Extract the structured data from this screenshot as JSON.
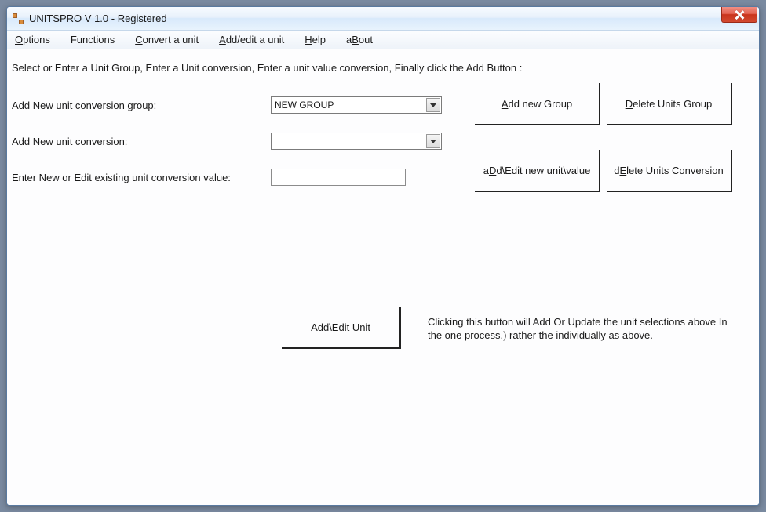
{
  "window": {
    "title": "UNITSPRO V 1.0 - Registered"
  },
  "menu": {
    "options": "Options",
    "functions": "Functions",
    "convert": "Convert a unit",
    "addedit": "Add/edit a unit",
    "help": "Help",
    "about": "aBout"
  },
  "labels": {
    "instruction": "Select or Enter a Unit Group, Enter a Unit conversion, Enter a unit value conversion, Finally click the Add Button :",
    "add_group": "Add New unit conversion group:",
    "add_conversion": "Add New unit conversion:",
    "enter_value": "Enter New or Edit existing unit conversion value:"
  },
  "fields": {
    "group_selected": "NEW GROUP",
    "conversion_selected": "",
    "value_text": ""
  },
  "buttons": {
    "add_group": "Add new Group",
    "delete_group": "Delete Units Group",
    "add_edit_unit_value": "aDd\\Edit new unit\\value",
    "delete_conversion": "dElete Units Conversion",
    "add_edit_unit": "Add\\Edit Unit"
  },
  "help_text": "Clicking this button will Add Or Update the unit selections above In the one process,) rather the individually as above."
}
